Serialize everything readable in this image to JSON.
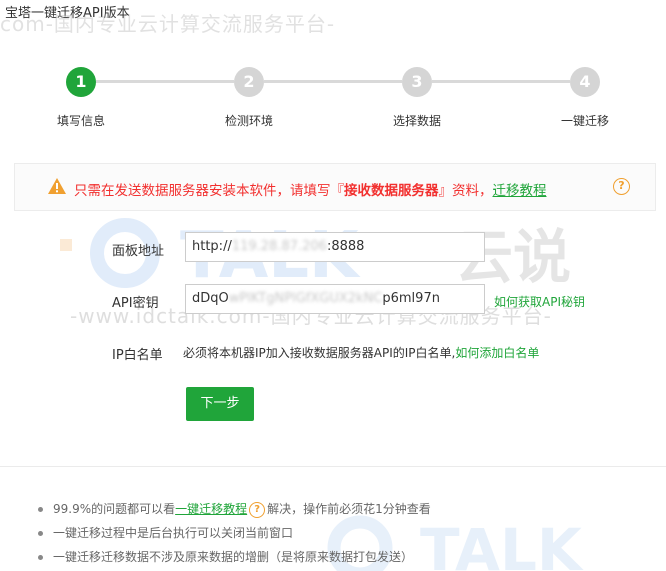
{
  "window": {
    "title": "宝塔一键迁移API版本"
  },
  "watermark": {
    "line": "com-国内专业云计算交流服务平台-",
    "mid_line": "-www.idctalk.com-国内专业云计算交流服务平台-",
    "brand": "TALK",
    "brand_cn": "云说"
  },
  "steps": [
    {
      "number": "1",
      "label": "填写信息",
      "active": true
    },
    {
      "number": "2",
      "label": "检测环境",
      "active": false
    },
    {
      "number": "3",
      "label": "选择数据",
      "active": false
    },
    {
      "number": "4",
      "label": "一键迁移",
      "active": false
    }
  ],
  "alert": {
    "text_before": "只需在发送数据服务器安装本软件，请填写『",
    "text_bold": "接收数据服务器",
    "text_after": "』资料，",
    "link": "迁移教程",
    "help_icon": "?"
  },
  "form": {
    "panel_url": {
      "label": "面板地址",
      "prefix": "http://",
      "masked": "119.28.87.206",
      "suffix": ":8888"
    },
    "api_key": {
      "label": "API密钥",
      "prefix": "dDqO",
      "masked": "wPlKTgNPlGfXGUX2kNC",
      "suffix": "p6ml97n",
      "help_link": "如何获取API秘钥"
    },
    "whitelist": {
      "label": "IP白名单",
      "hint": "必须将本机器IP加入接收数据服务器API的IP白名单,",
      "help_link": "如何添加白名单"
    },
    "next_button": "下一步"
  },
  "notes": {
    "n1_before": "99.9%的问题都可以看",
    "n1_link": "一键迁移教程",
    "n1_icon": "?",
    "n1_after": "解决，操作前必须花1分钟查看",
    "n2": "一键迁移过程中是后台执行可以关闭当前窗口",
    "n3": "一键迁移迁移数据不涉及原来数据的增删（是将原来数据打包发送）"
  },
  "colors": {
    "accent": "#20a53a",
    "warning": "#f2302f",
    "help": "#f0a030",
    "inactive": "#d5d5d5"
  }
}
